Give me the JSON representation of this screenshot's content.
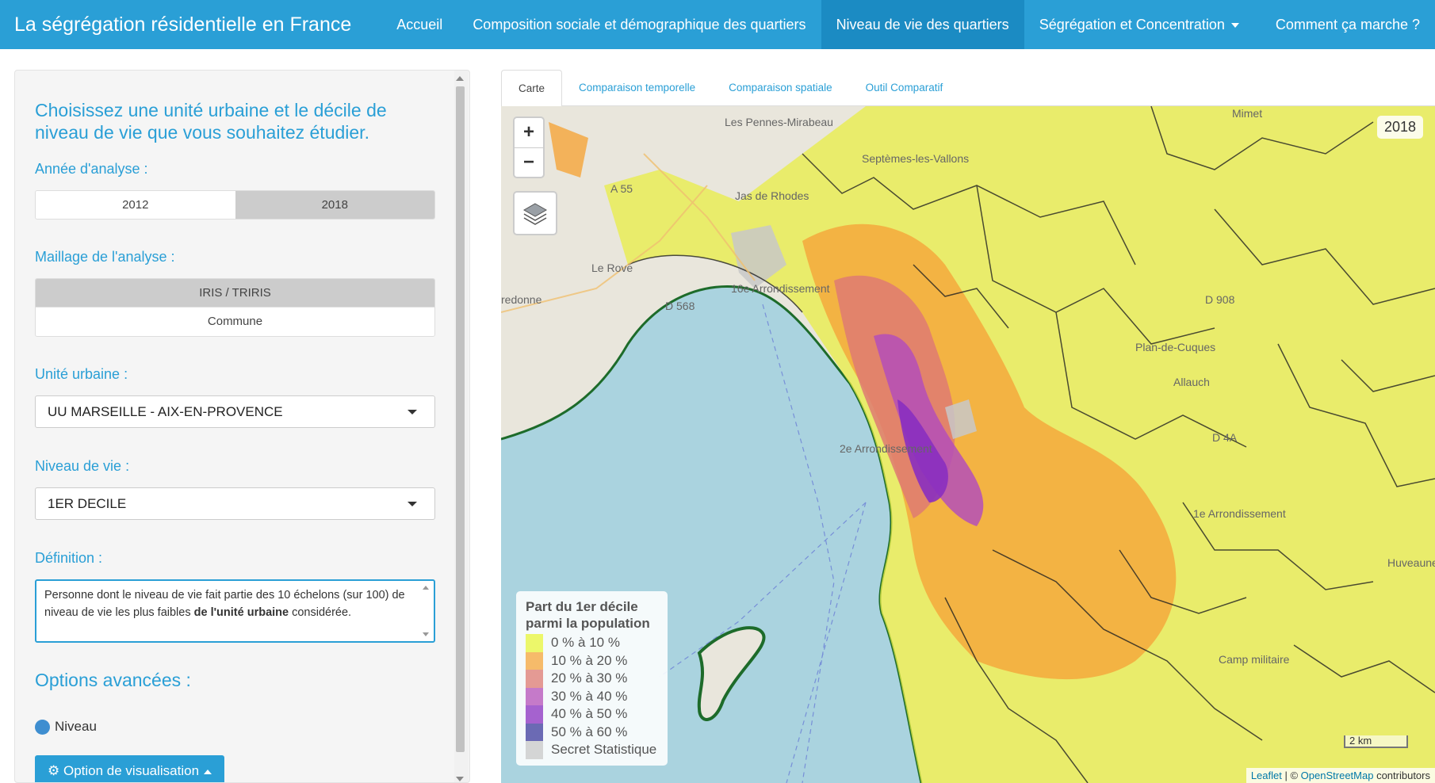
{
  "navbar": {
    "brand": "La ségrégation résidentielle en France",
    "items": [
      {
        "label": "Accueil"
      },
      {
        "label": "Composition sociale et démographique des quartiers"
      },
      {
        "label": "Niveau de vie des quartiers"
      },
      {
        "label": "Ségrégation et Concentration"
      }
    ],
    "help": "Comment ça marche ?"
  },
  "sidebar": {
    "title": "Choisissez une unité urbaine et le décile de niveau de vie que vous souhaitez étudier.",
    "year_label": "Année d'analyse :",
    "years": [
      "2012",
      "2018"
    ],
    "year_selected": "2018",
    "mesh_label": "Maillage de l'analyse :",
    "mesh_options": [
      "IRIS / TRIRIS",
      "Commune"
    ],
    "mesh_selected": "IRIS / TRIRIS",
    "unit_label": "Unité urbaine :",
    "unit_value": "UU MARSEILLE - AIX-EN-PROVENCE",
    "level_label": "Niveau de vie :",
    "level_value": "1ER DECILE",
    "definition_label": "Définition :",
    "definition_part1": "Personne dont le niveau de vie fait partie des 10 échelons (sur 100) de niveau de vie les plus faibles ",
    "definition_bold": "de l'unité urbaine",
    "definition_part2": " considérée.",
    "advanced_title": "Options avancées :",
    "radio_label": "Niveau",
    "viz_button": "Option de visualisation"
  },
  "tabs": [
    {
      "label": "Carte"
    },
    {
      "label": "Comparaison temporelle"
    },
    {
      "label": "Comparaison spatiale"
    },
    {
      "label": "Outil Comparatif"
    }
  ],
  "map": {
    "year": "2018",
    "zoom_in": "+",
    "zoom_out": "−",
    "legend": {
      "title": "Part du 1er décile parmi la population",
      "items": [
        {
          "label": "0 % à 10 %",
          "color": "#e8f53a"
        },
        {
          "label": "10 % à 20 %",
          "color": "#f5a53a"
        },
        {
          "label": "20 % à 30 %",
          "color": "#de7a72"
        },
        {
          "label": "30 % à 40 %",
          "color": "#b44fb8"
        },
        {
          "label": "40 % à 50 %",
          "color": "#8a2fc0"
        },
        {
          "label": "50 % à 60 %",
          "color": "#3c3a9c"
        },
        {
          "label": "Secret Statistique",
          "color": "#c8c8c8"
        }
      ]
    },
    "place_labels": [
      "Les Pennes-Mirabeau",
      "Septèmes-les-Vallons",
      "Jas de Rhodes",
      "Le Rove",
      "A 55",
      "D 568",
      "16e Arrondissement",
      "2e Arrondissement",
      "Plan-de-Cuques",
      "Allauch",
      "1e Arrondissement",
      "D 908",
      "D 4A",
      "Mimet",
      "Camp militaire",
      "Huveaune",
      "redonne"
    ],
    "scale": "2 km",
    "attribution_leaflet": "Leaflet",
    "attribution_sep": " | © ",
    "attribution_osm": "OpenStreetMap",
    "attribution_rest": " contributors"
  }
}
